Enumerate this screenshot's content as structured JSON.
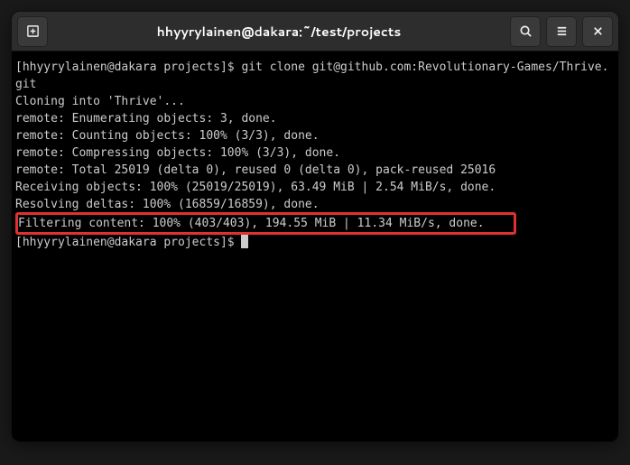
{
  "window": {
    "title": "hhyyrylainen@dakara:~/test/projects"
  },
  "terminal": {
    "prompt1": "[hhyyrylainen@dakara projects]$ git clone git@github.com:Revolutionary-Games/Thrive.git",
    "lines": [
      "Cloning into 'Thrive'...",
      "remote: Enumerating objects: 3, done.",
      "remote: Counting objects: 100% (3/3), done.",
      "remote: Compressing objects: 100% (3/3), done.",
      "remote: Total 25019 (delta 0), reused 0 (delta 0), pack-reused 25016",
      "Receiving objects: 100% (25019/25019), 63.49 MiB | 2.54 MiB/s, done.",
      "Resolving deltas: 100% (16859/16859), done."
    ],
    "highlighted": "Filtering content: 100% (403/403), 194.55 MiB | 11.34 MiB/s, done.",
    "prompt2": "[hhyyrylainen@dakara projects]$ "
  }
}
